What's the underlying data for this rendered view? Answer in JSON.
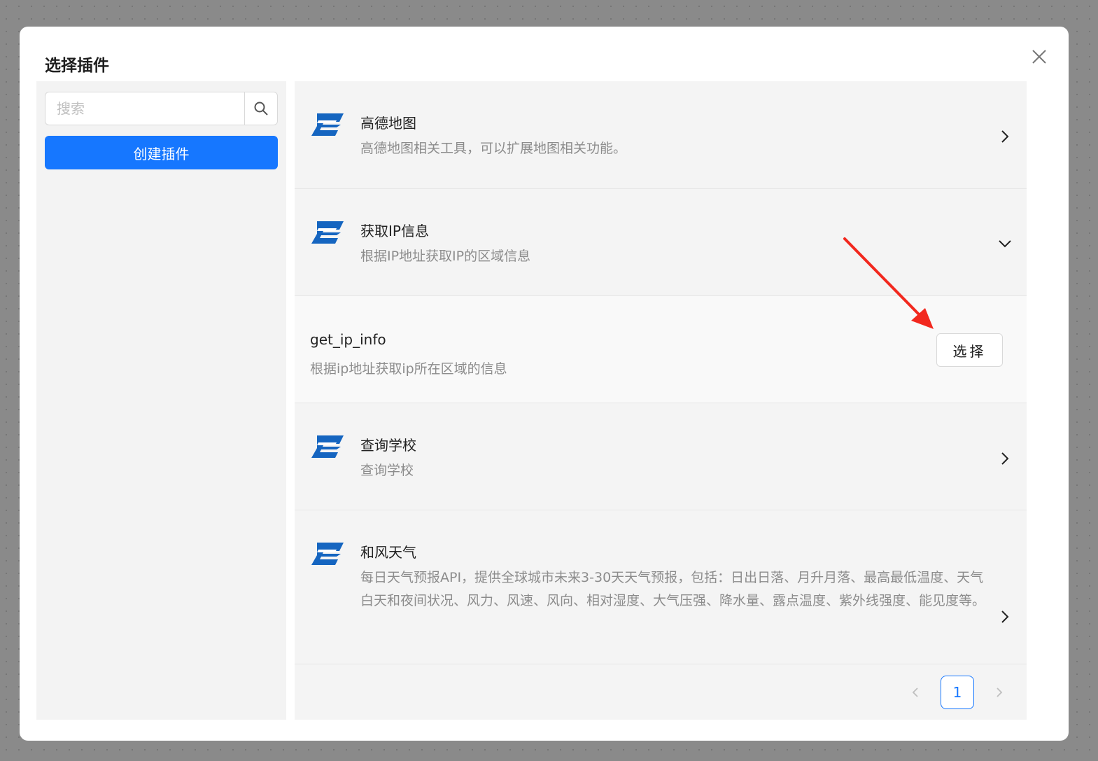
{
  "modal": {
    "title": "选择插件"
  },
  "sidebar": {
    "search": {
      "placeholder": "搜索"
    },
    "create_button": "创建插件"
  },
  "plugins": [
    {
      "name": "高德地图",
      "description": "高德地图相关工具，可以扩展地图相关功能。",
      "icon": "plugin-logo-icon",
      "expanded": false
    },
    {
      "name": "获取IP信息",
      "description": "根据IP地址获取IP的区域信息",
      "icon": "plugin-logo-icon",
      "expanded": true,
      "tools": [
        {
          "name": "get_ip_info",
          "description": "根据ip地址获取ip所在区域的信息",
          "select_label": "选择"
        }
      ]
    },
    {
      "name": "查询学校",
      "description": "查询学校",
      "icon": "plugin-logo-icon",
      "expanded": false
    },
    {
      "name": "和风天气",
      "description": "每日天气预报API，提供全球城市未来3-30天天气预报，包括：日出日落、月升月落、最高最低温度、天气白天和夜间状况、风力、风速、风向、相对湿度、大气压强、降水量、露点温度、紫外线强度、能见度等。",
      "icon": "plugin-logo-icon",
      "expanded": false
    }
  ],
  "pagination": {
    "current_page": "1"
  },
  "colors": {
    "primary": "#1677ff",
    "annotation_arrow": "#f2281e",
    "logo_blue": "#1565c0"
  }
}
